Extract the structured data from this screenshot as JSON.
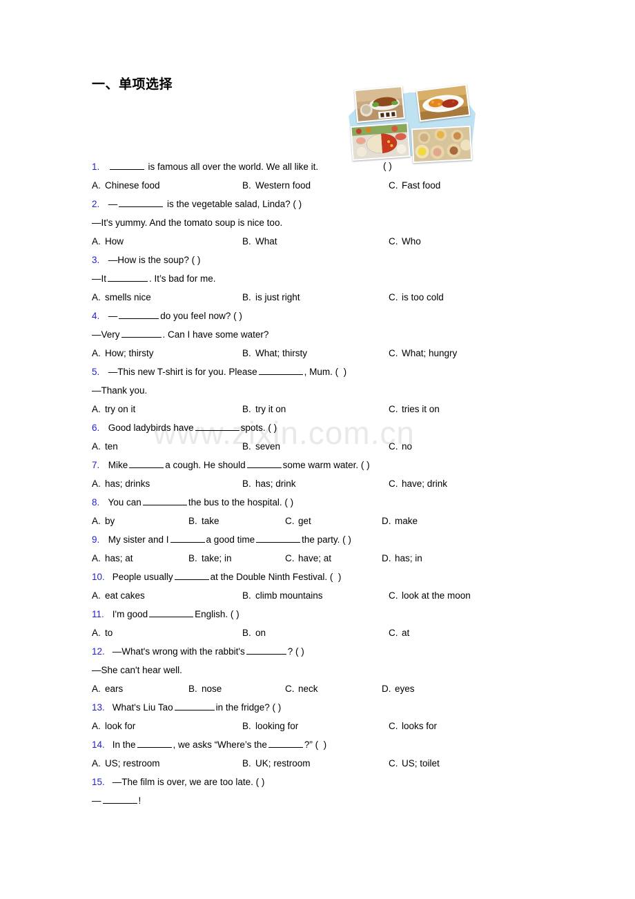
{
  "document": {
    "heading": "一、单项选择",
    "watermark": "www.zixin.com.cn"
  },
  "illustration": {
    "name": "food-collage",
    "background_color": "#bfe2f2",
    "photos": [
      {
        "name": "roast-duck",
        "alt": "Roast duck plate"
      },
      {
        "name": "sweet-and-sour-dish",
        "alt": "Sweet and sour dish on a platter"
      },
      {
        "name": "hot-pot",
        "alt": "Hot pot with side dishes"
      },
      {
        "name": "dim-sum",
        "alt": "Steamed dim sum baskets"
      }
    ]
  },
  "questions": [
    {
      "num": "1.",
      "lines": [
        "______ is famous all over the world. We all like it."
      ],
      "trailing_paren": "( )",
      "columns": 3,
      "options": [
        {
          "label": "A.",
          "text": "Chinese food"
        },
        {
          "label": "B.",
          "text": "Western food"
        },
        {
          "label": "C.",
          "text": "Fast food"
        }
      ]
    },
    {
      "num": "2.",
      "lines": [
        "—________ is the vegetable salad, Linda? (  )",
        "—It's yummy. And the tomato soup is nice too."
      ],
      "columns": 3,
      "options": [
        {
          "label": "A.",
          "text": "How"
        },
        {
          "label": "B.",
          "text": "What"
        },
        {
          "label": "C.",
          "text": "Who"
        }
      ]
    },
    {
      "num": "3.",
      "lines": [
        "—How is the soup? ( )",
        "—It _______. It's bad for me."
      ],
      "columns": 3,
      "options": [
        {
          "label": "A.",
          "text": "smells nice"
        },
        {
          "label": "B.",
          "text": "is just right"
        },
        {
          "label": "C.",
          "text": "is too cold"
        }
      ]
    },
    {
      "num": "4.",
      "lines": [
        "—_______ do you feel now? (  )",
        "—Very ________. Can I have some water?"
      ],
      "columns": 3,
      "options": [
        {
          "label": "A.",
          "text": "How; thirsty"
        },
        {
          "label": "B.",
          "text": "What; thirsty"
        },
        {
          "label": "C.",
          "text": "What; hungry"
        }
      ]
    },
    {
      "num": "5.",
      "lines": [
        "—This new T-shirt is for you. Please ________, Mum. (  )",
        "—Thank you."
      ],
      "columns": 3,
      "options": [
        {
          "label": "A.",
          "text": "try on it"
        },
        {
          "label": "B.",
          "text": "try it on"
        },
        {
          "label": "C.",
          "text": "tries it on"
        }
      ]
    },
    {
      "num": "6.",
      "lines": [
        "Good ladybirds have ________ spots. ( )"
      ],
      "columns": 3,
      "options": [
        {
          "label": "A.",
          "text": "ten"
        },
        {
          "label": "B.",
          "text": "seven"
        },
        {
          "label": "C.",
          "text": "no"
        }
      ]
    },
    {
      "num": "7.",
      "lines": [
        "Mike ______ a cough. He should ______ some warm water. ( )"
      ],
      "columns": 3,
      "options": [
        {
          "label": "A.",
          "text": "has; drinks"
        },
        {
          "label": "B.",
          "text": "has; drink"
        },
        {
          "label": "C.",
          "text": "have; drink"
        }
      ]
    },
    {
      "num": "8.",
      "lines": [
        "You can ________ the bus to the hospital. ( )"
      ],
      "columns": 4,
      "options": [
        {
          "label": "A.",
          "text": "by"
        },
        {
          "label": "B.",
          "text": "take"
        },
        {
          "label": "C.",
          "text": "get"
        },
        {
          "label": "D.",
          "text": "make"
        }
      ]
    },
    {
      "num": "9.",
      "lines": [
        "My sister and I ______ a good time ________ the party. ( )"
      ],
      "columns": 4,
      "options": [
        {
          "label": "A.",
          "text": "has; at"
        },
        {
          "label": "B.",
          "text": "take; in"
        },
        {
          "label": "C.",
          "text": "have; at"
        },
        {
          "label": "D.",
          "text": "has; in"
        }
      ]
    },
    {
      "num": "10.",
      "lines": [
        "People usually ______ at the Double Ninth Festival. (  )"
      ],
      "columns": 3,
      "options": [
        {
          "label": "A.",
          "text": "eat cakes"
        },
        {
          "label": "B.",
          "text": "climb mountains"
        },
        {
          "label": "C.",
          "text": "look at the moon"
        }
      ]
    },
    {
      "num": "11.",
      "lines": [
        "I'm good ________ English. ( )"
      ],
      "columns": 3,
      "options": [
        {
          "label": "A.",
          "text": "to"
        },
        {
          "label": "B.",
          "text": "on"
        },
        {
          "label": "C.",
          "text": "at"
        }
      ]
    },
    {
      "num": "12.",
      "lines": [
        "—What's wrong with the rabbit's _______? ( )",
        "—She can't hear well."
      ],
      "columns": 4,
      "options": [
        {
          "label": "A.",
          "text": "ears"
        },
        {
          "label": "B.",
          "text": "nose"
        },
        {
          "label": "C.",
          "text": "neck"
        },
        {
          "label": "D.",
          "text": "eyes"
        }
      ]
    },
    {
      "num": "13.",
      "lines": [
        "What's Liu Tao _______ in the fridge? ( )"
      ],
      "columns": 3,
      "options": [
        {
          "label": "A.",
          "text": "look for"
        },
        {
          "label": "B.",
          "text": "looking for"
        },
        {
          "label": "C.",
          "text": "looks for"
        }
      ]
    },
    {
      "num": "14.",
      "lines": [
        "In the ______, we asks “Where’s the ______?” (  )"
      ],
      "columns": 3,
      "options": [
        {
          "label": "A.",
          "text": "US; restroom"
        },
        {
          "label": "B.",
          "text": "UK; restroom"
        },
        {
          "label": "C.",
          "text": "US; toilet"
        }
      ]
    },
    {
      "num": "15.",
      "lines": [
        "—The film is over, we are too late. (  )",
        "—______!"
      ],
      "columns": 0,
      "options": []
    }
  ]
}
